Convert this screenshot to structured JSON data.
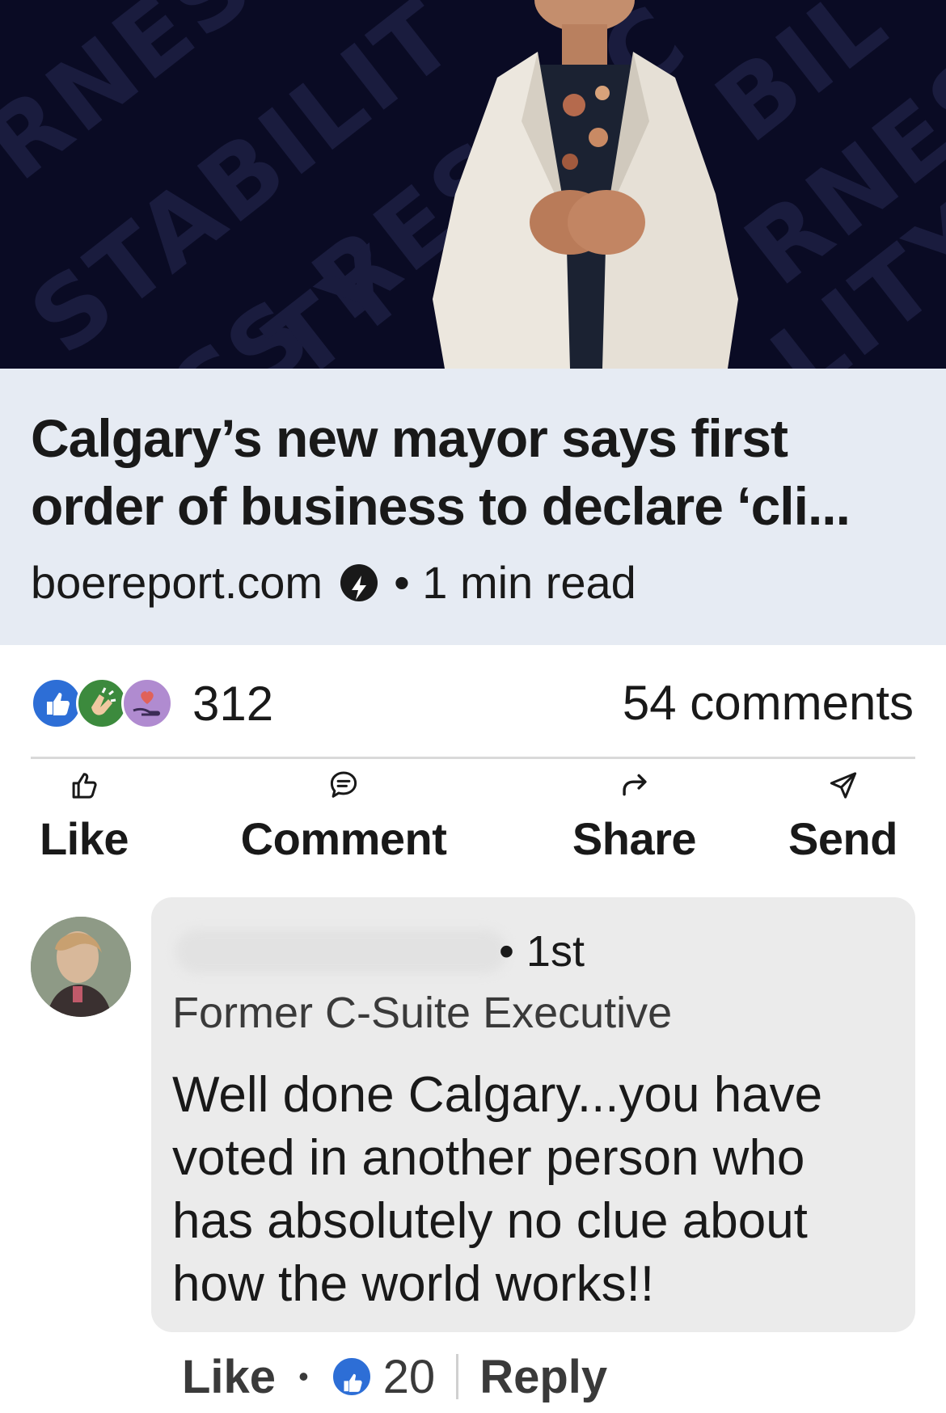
{
  "article": {
    "headline": "Calgary’s new mayor says first order of business to declare ‘cli...",
    "source": "boereport.com",
    "read_time": "• 1 min read"
  },
  "hero": {
    "bg_words": [
      "RNES",
      "STABILIT",
      "SS RESPEC",
      "TY",
      "BIL",
      "RNES",
      "LITY"
    ]
  },
  "social": {
    "reaction_count": "312",
    "comments": "54 comments"
  },
  "actions": {
    "like": "Like",
    "comment": "Comment",
    "share": "Share",
    "send": "Send"
  },
  "comment": {
    "degree": "• 1st",
    "role": "Former C-Suite Executive",
    "text": "Well done Calgary...you have voted in another person who has absolutely no clue about how the world works!!",
    "like_label": "Like",
    "separator": "•",
    "like_count": "20",
    "reply_label": "Reply"
  },
  "colors": {
    "hero_bg": "#0a0b24",
    "article_bg": "#e6ebf3",
    "like_blue": "#2d6ed6",
    "bubble_bg": "#ebebeb"
  }
}
